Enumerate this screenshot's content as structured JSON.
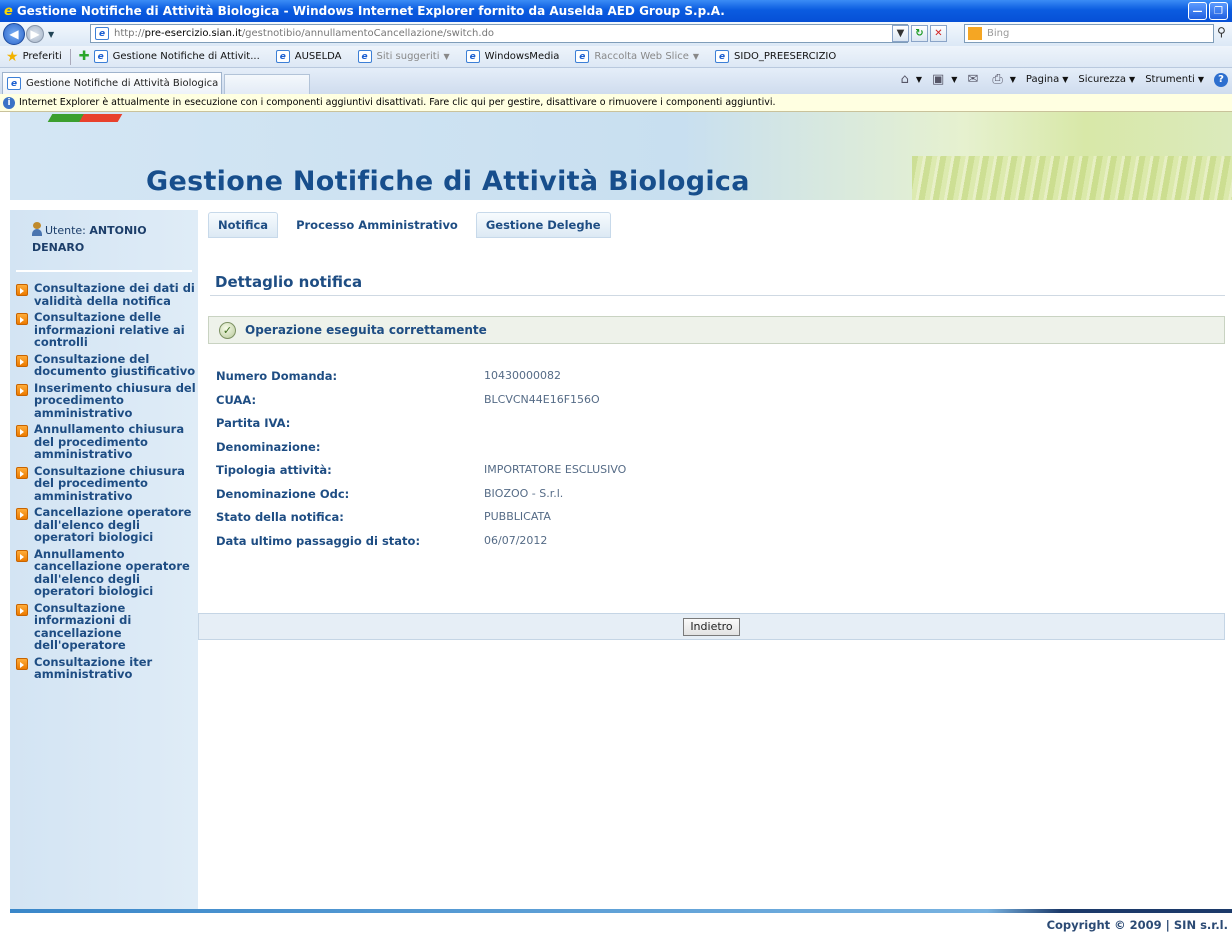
{
  "browser": {
    "window_title": "Gestione Notifiche di Attività Biologica - Windows Internet Explorer fornito da Auselda AED Group S.p.A.",
    "url_prefix": "http://",
    "url_domain": "pre-esercizio.sian.it",
    "url_path": "/gestnotibio/annullamentoCancellazione/switch.do",
    "search_placeholder": "Bing",
    "favorites_label": "Preferiti",
    "favorites": [
      {
        "label": "Gestione Notifiche di Attivit...",
        "dropdown": false,
        "muted": false
      },
      {
        "label": "AUSELDA",
        "dropdown": false,
        "muted": false
      },
      {
        "label": "Siti suggeriti",
        "dropdown": true,
        "muted": true
      },
      {
        "label": "WindowsMedia",
        "dropdown": false,
        "muted": false
      },
      {
        "label": "Raccolta Web Slice",
        "dropdown": true,
        "muted": true
      },
      {
        "label": "SIDO_PREESERCIZIO",
        "dropdown": false,
        "muted": false
      }
    ],
    "active_tab": "Gestione Notifiche di Attività Biologica",
    "commands": {
      "page": "Pagina",
      "safety": "Sicurezza",
      "tools": "Strumenti"
    },
    "infobar_text": "Internet Explorer è attualmente in esecuzione con i componenti aggiuntivi disattivati. Fare clic qui per gestire, disattivare o rimuovere i componenti aggiuntivi."
  },
  "site": {
    "title": "Gestione Notifiche di Attività Biologica"
  },
  "user": {
    "prefix": "Utente:",
    "name": "ANTONIO DENARO"
  },
  "sidebar": {
    "items": [
      {
        "label": "Consultazione dei dati di validità della notifica"
      },
      {
        "label": "Consultazione delle informazioni relative ai controlli"
      },
      {
        "label": "Consultazione del documento giustificativo"
      },
      {
        "label": "Inserimento chiusura del procedimento amministrativo"
      },
      {
        "label": "Annullamento chiusura del procedimento amministrativo"
      },
      {
        "label": "Consultazione chiusura del procedimento amministrativo"
      },
      {
        "label": "Cancellazione operatore dall'elenco degli operatori biologici"
      },
      {
        "label": "Annullamento cancellazione operatore dall'elenco degli operatori biologici"
      },
      {
        "label": "Consultazione informazioni di cancellazione dell'operatore"
      },
      {
        "label": "Consultazione iter amministrativo"
      }
    ]
  },
  "main": {
    "tabs": [
      {
        "label": "Notifica",
        "boxed": true
      },
      {
        "label": "Processo Amministrativo",
        "boxed": false
      },
      {
        "label": "Gestione Deleghe",
        "boxed": true
      }
    ],
    "heading": "Dettaglio notifica",
    "success_message": "Operazione eseguita correttamente",
    "details": [
      {
        "label": "Numero Domanda:",
        "value": "10430000082"
      },
      {
        "label": "CUAA:",
        "value": "BLCVCN44E16F156O"
      },
      {
        "label": "Partita IVA:",
        "value": ""
      },
      {
        "label": "Denominazione:",
        "value": ""
      },
      {
        "label": "Tipologia attività:",
        "value": "IMPORTATORE ESCLUSIVO"
      },
      {
        "label": "Denominazione Odc:",
        "value": "BIOZOO - S.r.l."
      },
      {
        "label": "Stato della notifica:",
        "value": "PUBBLICATA"
      },
      {
        "label": "Data ultimo passaggio di stato:",
        "value": "06/07/2012"
      }
    ],
    "back_button": "Indietro"
  },
  "footer": {
    "copyright": "Copyright © 2009 | SIN s.r.l."
  }
}
